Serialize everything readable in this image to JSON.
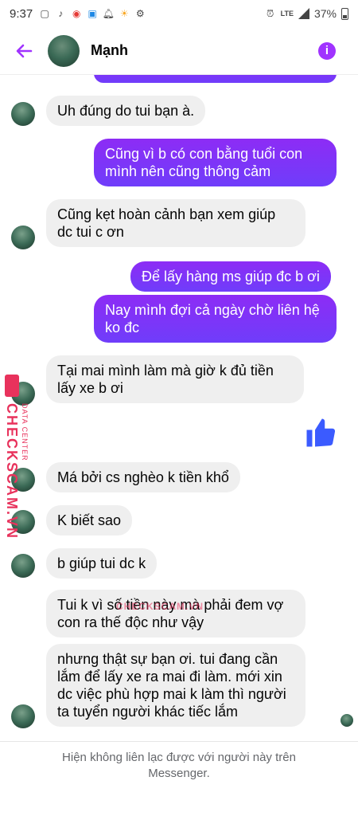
{
  "status_bar": {
    "time": "9:37",
    "left_icons": [
      "message-icon",
      "tiktok-icon",
      "game-icon",
      "zalo-icon",
      "notification-bell-icon",
      "sun-icon",
      "settings-icon"
    ],
    "right_icons": [
      "alarm-icon",
      "lte-icon",
      "signal-icon",
      "battery-icon"
    ],
    "lte": "LTE",
    "battery": "37%"
  },
  "header": {
    "contact_name": "Mạnh",
    "back_icon": "arrow-left-icon",
    "info_icon": "info-icon",
    "accent_color": "#a033ff"
  },
  "messages": [
    {
      "id": "m1",
      "direction": "in",
      "text": "Uh đúng do tui bạn à."
    },
    {
      "id": "m2",
      "direction": "out",
      "lines": [
        "Cũng vì b có con bằng tuổi con",
        "mình nên cũng thông cảm"
      ]
    },
    {
      "id": "m3",
      "direction": "in",
      "lines": [
        "Cũng kẹt hoàn cảnh bạn xem giúp",
        "dc tui c ơn"
      ]
    },
    {
      "id": "m4",
      "direction": "out",
      "text": "Để lấy hàng ms giúp đc b ơi"
    },
    {
      "id": "m5",
      "direction": "out",
      "lines": [
        "Nay mình đợi cả ngày chờ liên hệ",
        "ko đc"
      ]
    },
    {
      "id": "m6",
      "direction": "in",
      "lines": [
        "Tại mai mình làm mà giờ k đủ tiền",
        "lấy xe b ơi"
      ]
    },
    {
      "id": "m7",
      "direction": "out",
      "type": "like",
      "icon": "thumbs-up-icon"
    },
    {
      "id": "m8",
      "direction": "in",
      "text": "Má bởi cs nghèo k tiền khổ"
    },
    {
      "id": "m9",
      "direction": "in",
      "text": "K biết sao"
    },
    {
      "id": "m10",
      "direction": "in",
      "text": "b giúp tui dc k"
    },
    {
      "id": "m11",
      "direction": "in",
      "lines": [
        "Tui k vì số tiền này mà phải đem vợ",
        "con ra thế độc như vậy"
      ]
    },
    {
      "id": "m12",
      "direction": "in",
      "lines": [
        "nhưng thật sự bạn ơi. tui đang cần",
        "lắm để lấy xe ra mai đi làm. mới xin",
        "dc việc phù hợp mai k làm thì người",
        "ta tuyển người khác tiếc lắm"
      ]
    }
  ],
  "watermark": {
    "side_text": "CHECKSCAM.VN",
    "side_subtext": "DATA CENTER",
    "center_text": "CHECKSCAM.VN"
  },
  "footer": {
    "notice_line1": "Hiện không liên lạc được với người này trên",
    "notice_line2": "Messenger."
  },
  "colors": {
    "outgoing_bubble": "#8d2cf5",
    "incoming_bubble": "#efefef",
    "like": "#3b5bff",
    "watermark": "#e8325c"
  }
}
